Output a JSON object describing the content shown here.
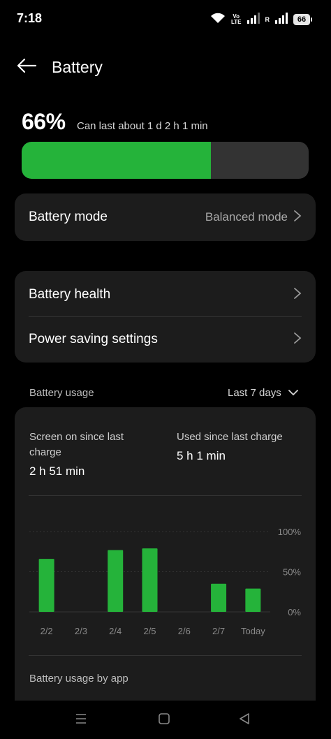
{
  "status_bar": {
    "time": "7:18",
    "volte_top": "Vo",
    "volte_bottom": "LTE",
    "roaming": "R",
    "battery_level": "66",
    "icons": [
      "wifi-icon",
      "signal-icon",
      "signal-icon",
      "battery-icon"
    ]
  },
  "header": {
    "back_icon": "back-arrow-icon",
    "title": "Battery"
  },
  "summary": {
    "percent_text": "66%",
    "estimate": "Can last about 1 d 2 h 1 min",
    "level": 0.66,
    "fill_color": "#25b33a"
  },
  "battery_mode": {
    "label": "Battery mode",
    "value": "Balanced mode"
  },
  "settings": {
    "health_label": "Battery health",
    "power_saving_label": "Power saving settings"
  },
  "usage": {
    "section_label": "Battery usage",
    "range": "Last 7 days",
    "screen_on_label_line1": "Screen on since last",
    "screen_on_label_line2": "charge",
    "screen_on_value": "2 h 51 min",
    "used_label": "Used since last charge",
    "used_value": "5 h 1 min",
    "by_app_label": "Battery usage by app"
  },
  "chart_data": {
    "type": "bar",
    "categories": [
      "2/2",
      "2/3",
      "2/4",
      "2/5",
      "2/6",
      "2/7",
      "Today"
    ],
    "values": [
      66,
      0,
      77,
      79,
      0,
      35,
      29
    ],
    "ylim": [
      0,
      100
    ],
    "yticks": [
      "100%",
      "50%",
      "0%"
    ],
    "bar_color": "#25b33a",
    "grid": true
  },
  "nav_bar": {
    "icons": [
      "recents-icon",
      "home-icon",
      "back-icon"
    ]
  }
}
